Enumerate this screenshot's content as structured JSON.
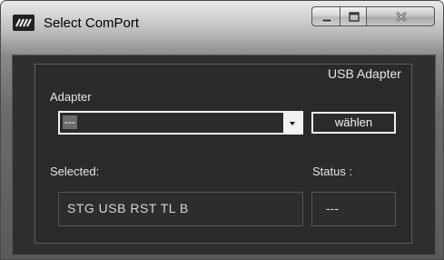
{
  "window": {
    "title": "Select ComPort"
  },
  "caption_buttons": {
    "minimize": "minimize",
    "maximize": "maximize",
    "close": "close"
  },
  "panel": {
    "header": "USB Adapter",
    "adapter_label": "Adapter",
    "adapter_select_value": "---",
    "choose_button": "wählen",
    "selected_label": "Selected:",
    "status_label": "Status :",
    "selected_value": "STG USB RST TL B",
    "status_value": "---"
  },
  "icons": {
    "app": "app-logo-icon",
    "dropdown": "chevron-down-icon"
  }
}
